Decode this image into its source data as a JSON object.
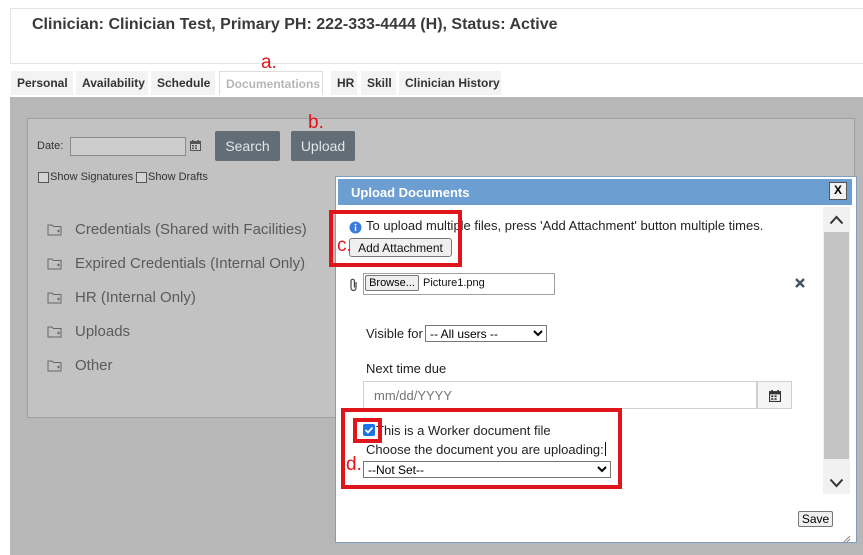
{
  "header": {
    "title": "Clinician: Clinician Test, Primary PH: 222-333-4444 (H), Status: Active"
  },
  "tabs": [
    {
      "label": "Personal"
    },
    {
      "label": "Availability"
    },
    {
      "label": "Schedule"
    },
    {
      "label": "Documentations"
    },
    {
      "label": "HR"
    },
    {
      "label": "Skill"
    },
    {
      "label": "Clinician History"
    }
  ],
  "annotations": {
    "a": "a.",
    "b": "b.",
    "c": "c.",
    "d": "d."
  },
  "filters": {
    "date_label": "Date:",
    "search_label": "Search",
    "upload_label": "Upload",
    "show_signatures": "Show Signatures",
    "show_drafts": "Show Drafts"
  },
  "folders": [
    {
      "label": "Credentials (Shared with Facilities)"
    },
    {
      "label": "Expired Credentials (Internal Only)"
    },
    {
      "label": "HR (Internal Only)"
    },
    {
      "label": "Uploads"
    },
    {
      "label": "Other"
    }
  ],
  "dialog": {
    "title": "Upload Documents",
    "close_label": "X",
    "info_text": "To upload multiple files, press 'Add Attachment' button multiple times.",
    "add_attachment_label": "Add Attachment",
    "browse_label": "Browse...",
    "file_name": "Picture1.png",
    "visible_for_label": "Visible for",
    "visible_for_value": "-- All users --",
    "next_time_due_label": "Next time due",
    "date_placeholder": "mm/dd/YYYY",
    "worker_checkbox_label": "This is a Worker document file",
    "worker_checked": true,
    "choose_label": "Choose the document you are uploading:",
    "document_value": "--Not Set--",
    "save_label": "Save"
  },
  "colors": {
    "accent": "#6c9ed1",
    "highlight": "#e0141b",
    "dark_button": "#626d76",
    "overlay": "#b7b7b7"
  }
}
